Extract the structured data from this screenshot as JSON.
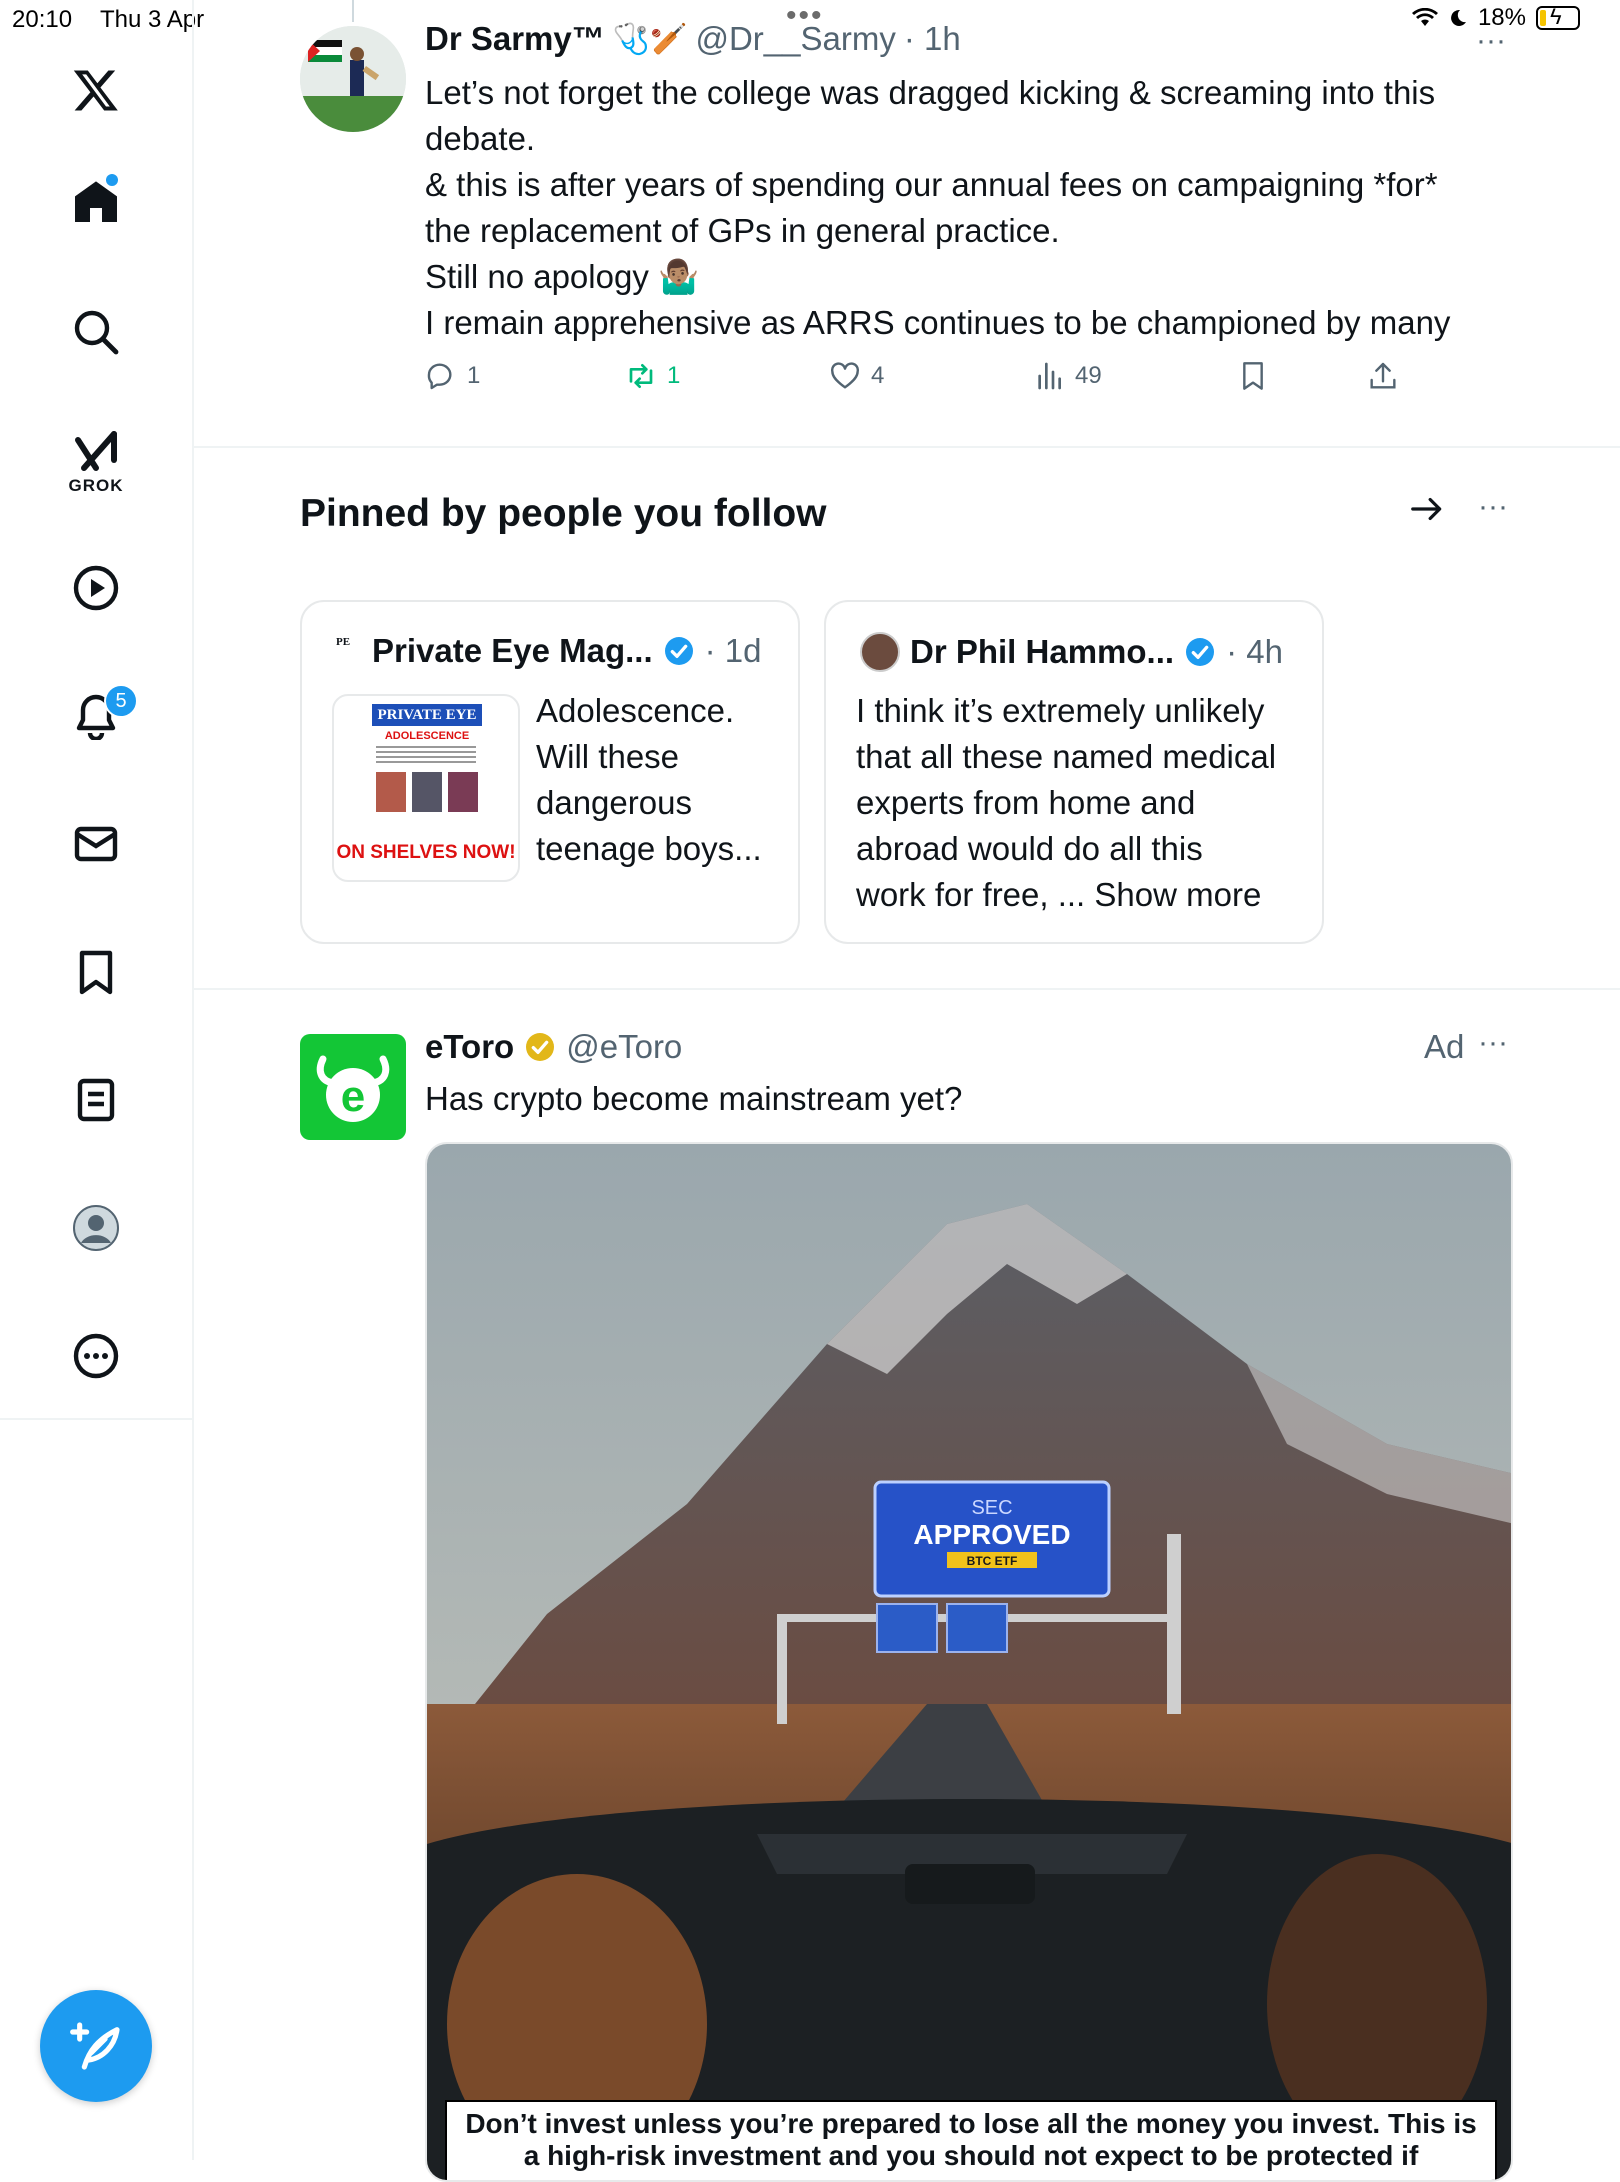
{
  "status_bar": {
    "time": "20:10",
    "date": "Thu 3 Apr",
    "battery": "18%"
  },
  "sidebar": {
    "items": [
      {
        "name": "x-logo"
      },
      {
        "name": "home"
      },
      {
        "name": "search"
      },
      {
        "name": "grok",
        "label": "GROK"
      },
      {
        "name": "video"
      },
      {
        "name": "notifications",
        "badge": "5"
      },
      {
        "name": "messages"
      },
      {
        "name": "bookmarks"
      },
      {
        "name": "lists"
      },
      {
        "name": "profile"
      },
      {
        "name": "more"
      }
    ]
  },
  "tweet": {
    "name": "Dr Sarmy™",
    "emoji": "🩺🏏",
    "handle": "@Dr__Sarmy",
    "time": "· 1h",
    "lines": [
      "Let’s not forget the college was dragged kicking & screaming into this",
      "debate.",
      "& this is after years of spending our annual fees on campaigning *for*",
      "the replacement of GPs in general practice.",
      "Still no apology 🤷🏽‍♂️",
      "I remain apprehensive as ARRS continues to be championed by many"
    ],
    "replies": "1",
    "reposts": "1",
    "likes": "4",
    "views": "49"
  },
  "pinned": {
    "title": "Pinned by people you follow",
    "cards": [
      {
        "name": "Private Eye Mag...",
        "time": "· 1d",
        "thumb_title": "PRIVATE EYE",
        "thumb_sub": "ADOLESCENCE",
        "thumb_banner": "ON SHELVES NOW!",
        "text_lines": [
          "Adolescence.",
          "Will these",
          "dangerous",
          "teenage boys..."
        ]
      },
      {
        "name": "Dr Phil Hammo...",
        "time": "· 4h",
        "text_lines": [
          "I think it’s extremely unlikely",
          "that all these named medical",
          "experts from home and",
          "abroad would do all this",
          "work for free, ... Show more"
        ]
      }
    ]
  },
  "ad": {
    "name": "eToro",
    "handle": "@eToro",
    "ad_label": "Ad",
    "text": "Has crypto become mainstream yet?",
    "sign_top": "SEC",
    "sign_main": "APPROVED",
    "sign_sub": "BTC ETF",
    "disclaimer_1": "Don’t invest unless you’re prepared to lose all the money you invest. This is",
    "disclaimer_2": "a high-risk investment and you should not expect to be protected if"
  },
  "colors": {
    "accent": "#1d9bf0",
    "repost_green": "#00ba7c",
    "etoro_green": "#13c636",
    "gold_verified": "#e2b719",
    "muted": "#536471"
  }
}
